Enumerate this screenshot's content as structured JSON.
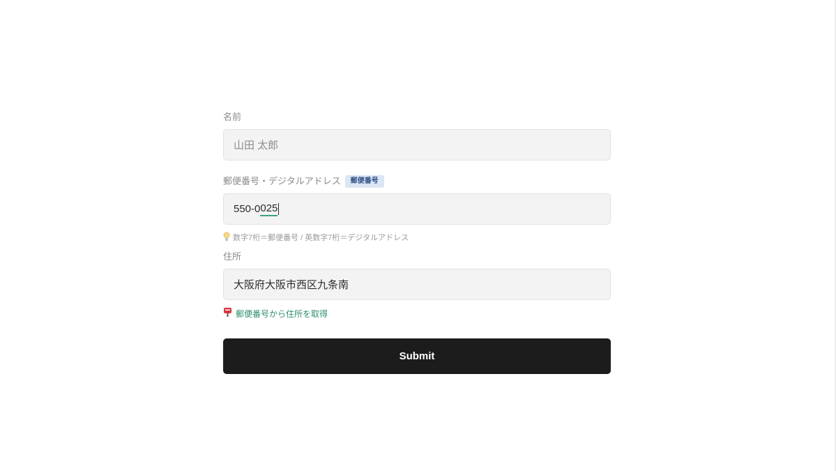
{
  "form": {
    "name": {
      "label": "名前",
      "placeholder": "山田 太郎"
    },
    "postal": {
      "label": "郵便番号・デジタルアドレス",
      "badge": "郵便番号",
      "value_prefix": "550-0",
      "value_underlined": "025",
      "hint_icon": "lightbulb-icon",
      "hint": "数字7桁＝郵便番号 / 英数字7桁＝デジタルアドレス"
    },
    "address": {
      "label": "住所",
      "value": "大阪府大阪市西区九条南",
      "fetch_icon": "postbox-icon",
      "fetch_label": "郵便番号から住所を取得"
    },
    "submit_label": "Submit"
  },
  "colors": {
    "accent_green": "#2f8f6a",
    "button_dark": "#1c1c1c",
    "badge_bg": "#dbe6f4",
    "badge_text": "#2d4e86"
  }
}
